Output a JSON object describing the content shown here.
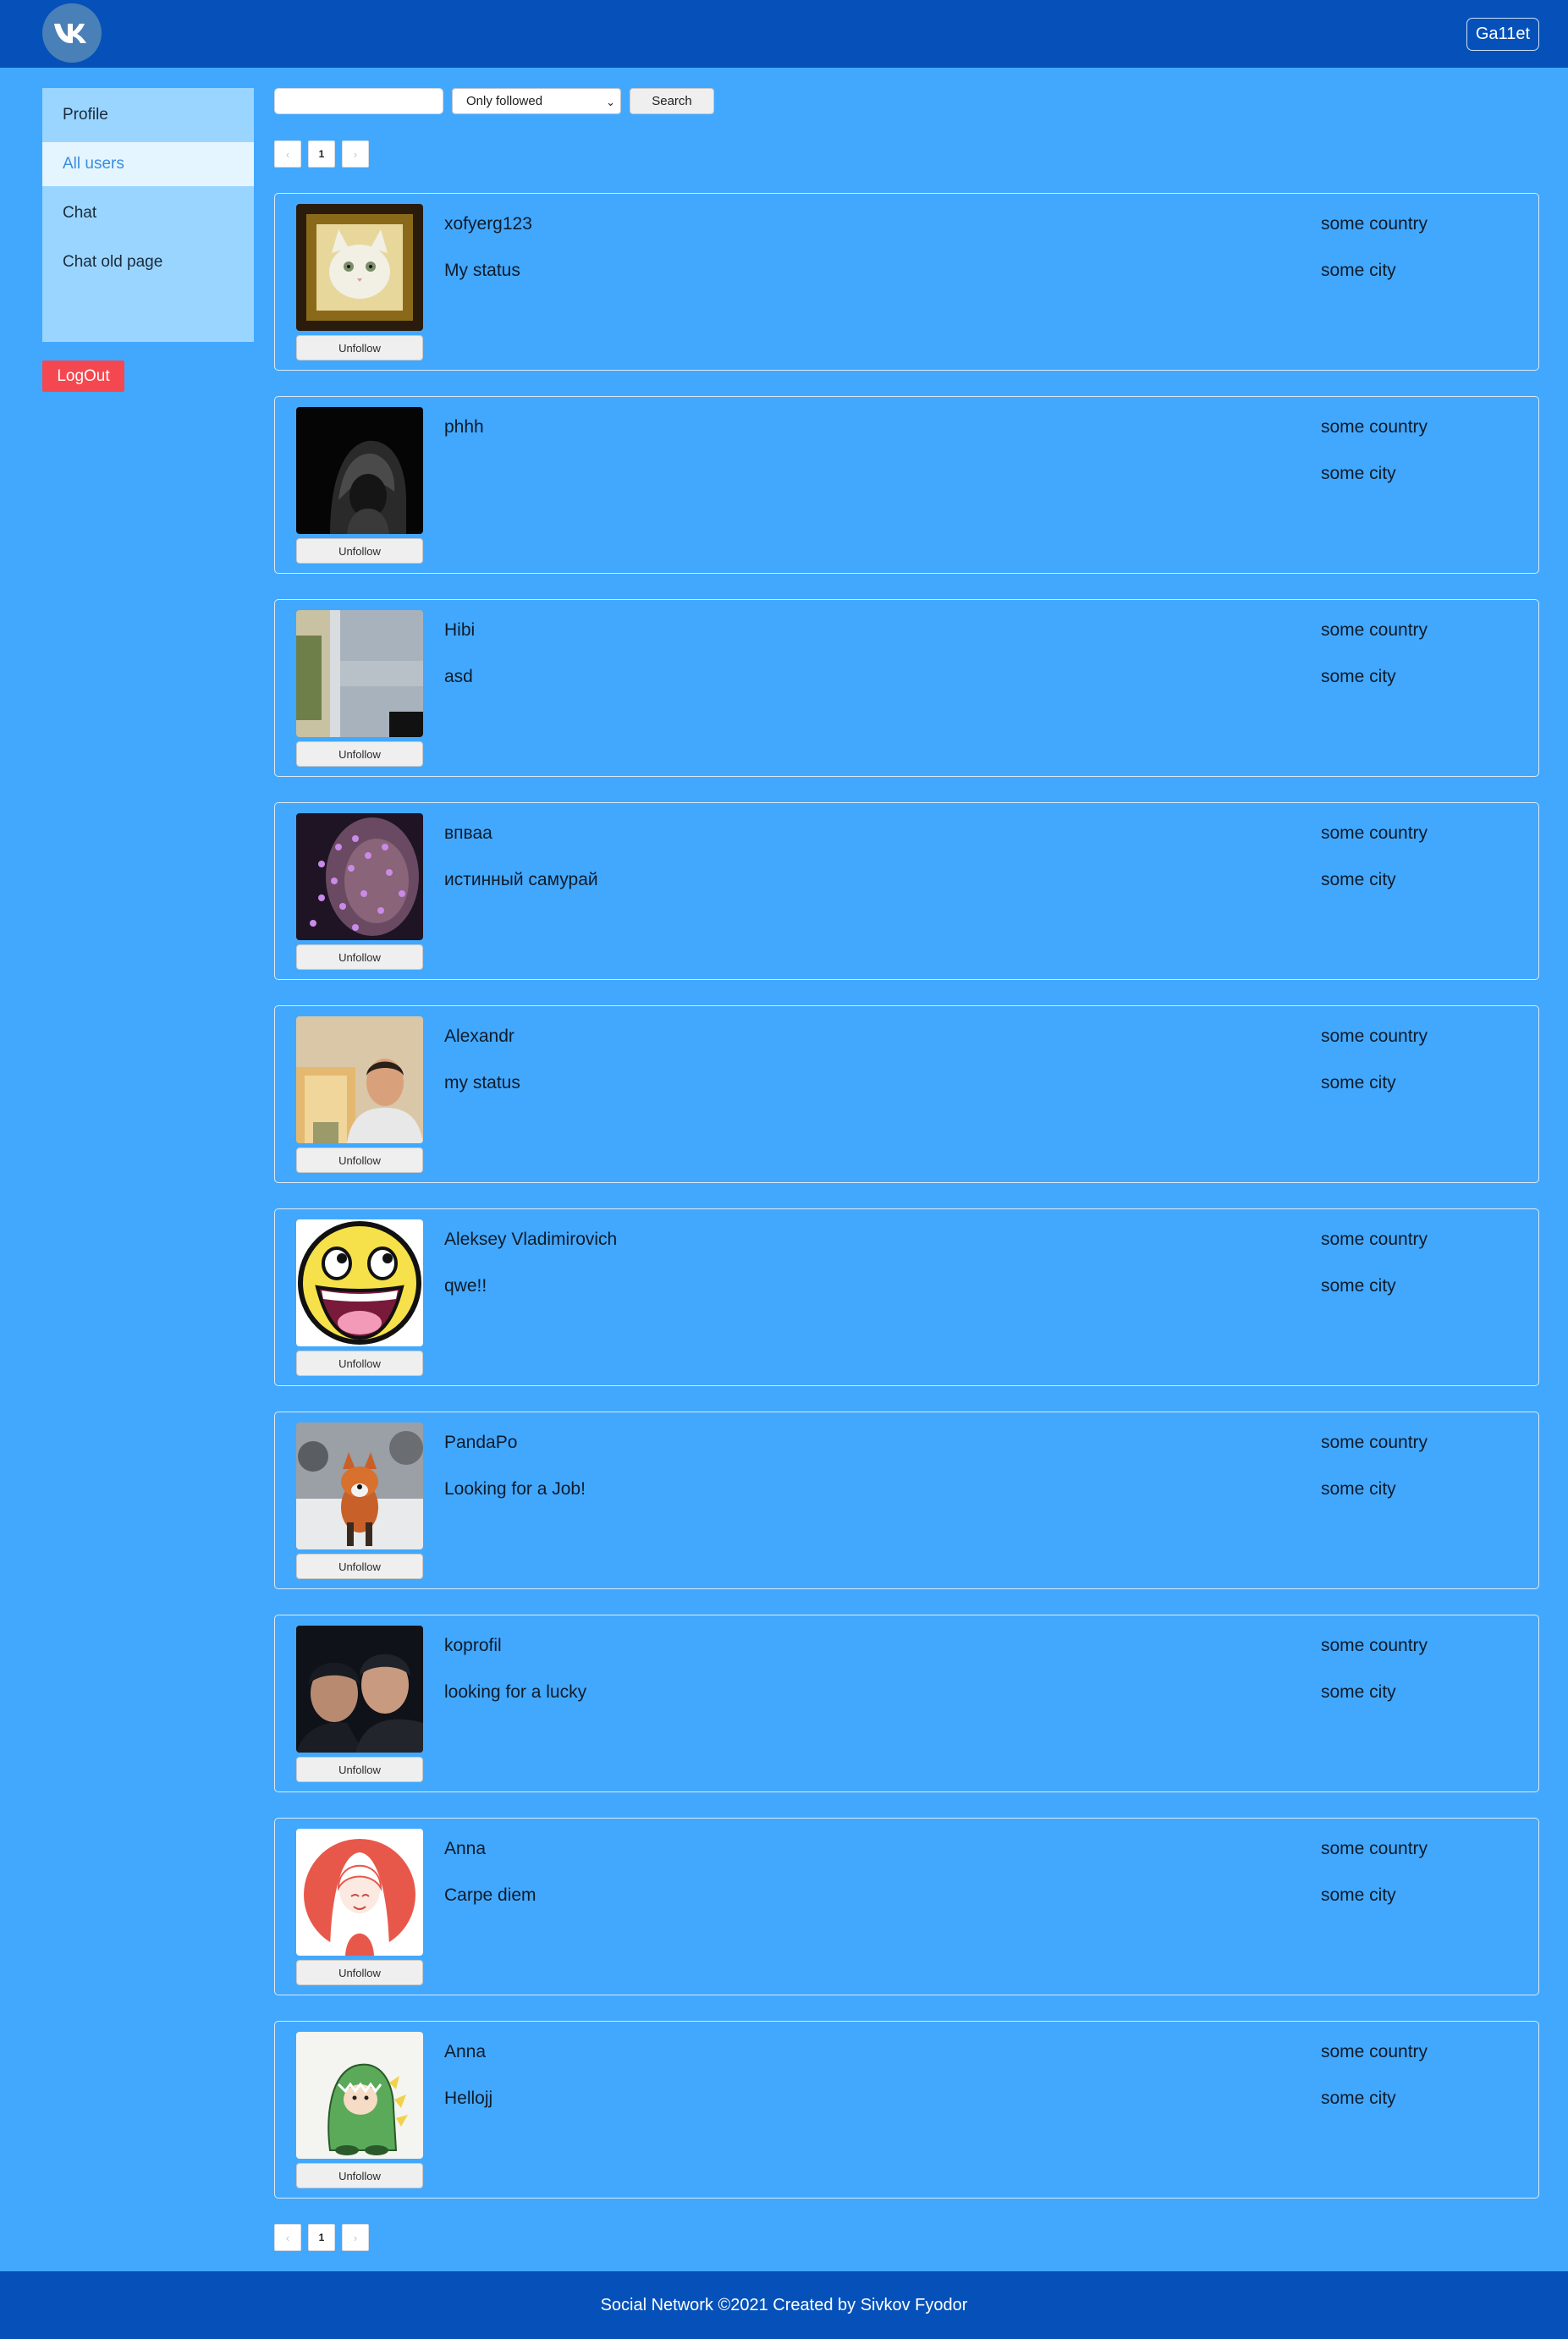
{
  "header": {
    "logo_icon": "vk-logo-icon",
    "login": "Ga11et"
  },
  "sidebar": {
    "items": [
      {
        "label": "Profile"
      },
      {
        "label": "All users"
      },
      {
        "label": "Chat"
      },
      {
        "label": "Chat old page"
      }
    ],
    "active_item": "All users",
    "logout_label": "LogOut"
  },
  "search": {
    "value": "",
    "filter_selected": "Only followed",
    "button_label": "Search"
  },
  "pagination": {
    "prev": "‹",
    "current_page": "1",
    "next": "›"
  },
  "users": [
    {
      "name": "xofyerg123",
      "status": "My status",
      "country": "some country",
      "city": "some city",
      "button": "Unfollow",
      "avatar": "cat-photo"
    },
    {
      "name": "phhh",
      "status": "",
      "country": "some country",
      "city": "some city",
      "button": "Unfollow",
      "avatar": "hooded-figure-photo"
    },
    {
      "name": "Hibi",
      "status": "asd",
      "country": "some country",
      "city": "some city",
      "button": "Unfollow",
      "avatar": "landscape-photo"
    },
    {
      "name": "впваа",
      "status": "истинный самурай",
      "country": "some country",
      "city": "some city",
      "button": "Unfollow",
      "avatar": "face-with-dots-photo"
    },
    {
      "name": "Alexandr",
      "status": "my status",
      "country": "some country",
      "city": "some city",
      "button": "Unfollow",
      "avatar": "man-portrait-photo"
    },
    {
      "name": "Aleksey Vladimirovich",
      "status": "qwe!!",
      "country": "some country",
      "city": "some city",
      "button": "Unfollow",
      "avatar": "smiley-face"
    },
    {
      "name": "PandaPo",
      "status": "Looking for a Job!",
      "country": "some country",
      "city": "some city",
      "button": "Unfollow",
      "avatar": "fox-photo"
    },
    {
      "name": "koprofil",
      "status": "looking for a lucky",
      "country": "some country",
      "city": "some city",
      "button": "Unfollow",
      "avatar": "two-men-photo"
    },
    {
      "name": "Anna",
      "status": "Carpe diem",
      "country": "some country",
      "city": "some city",
      "button": "Unfollow",
      "avatar": "girl-illustration"
    },
    {
      "name": "Anna",
      "status": "Hellojj",
      "country": "some country",
      "city": "some city",
      "button": "Unfollow",
      "avatar": "dinosaur-costume-illustration"
    }
  ],
  "footer": {
    "text": "Social Network ©2021 Created by Sivkov Fyodor"
  },
  "colors": {
    "header_bg": "#0551b9",
    "page_bg": "#42a8fd",
    "sidebar_bg": "#9ad5ff",
    "active_nav_bg": "#e4f5ff",
    "logout_bg": "#f5474f"
  }
}
